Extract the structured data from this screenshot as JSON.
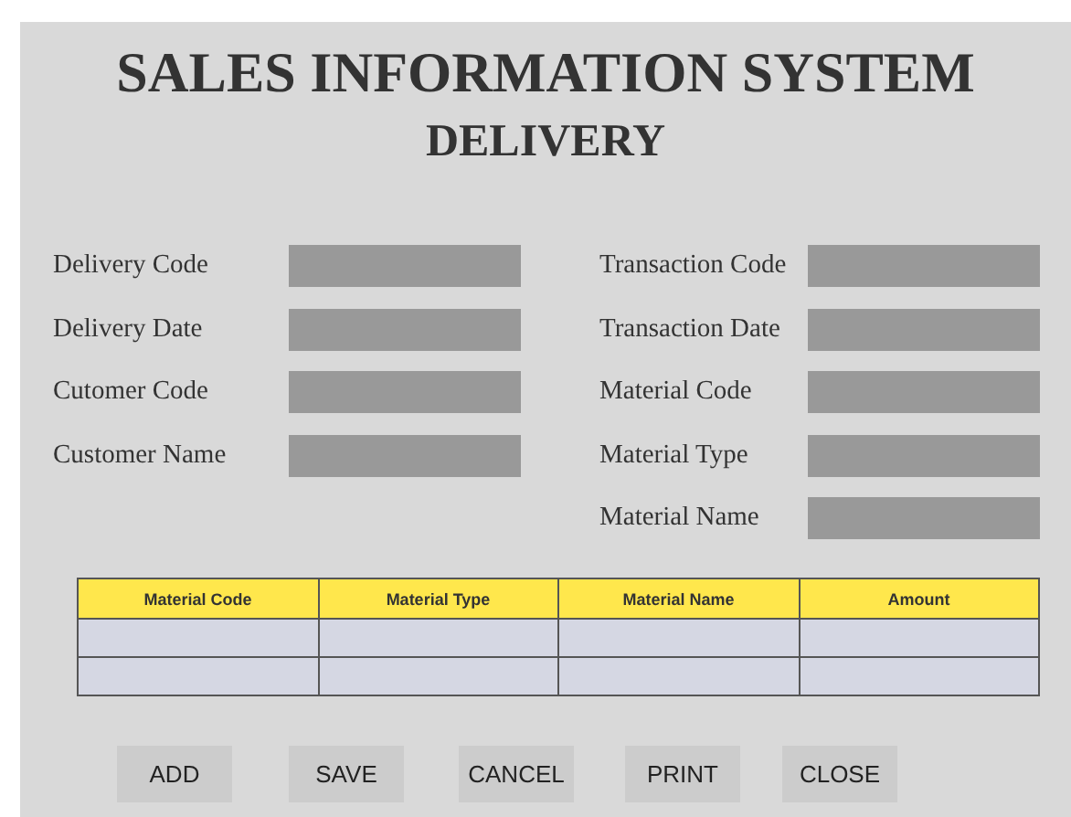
{
  "title": "SALES INFORMATION SYSTEM",
  "subtitle": "DELIVERY",
  "left_fields": [
    {
      "label": "Delivery Code"
    },
    {
      "label": "Delivery Date"
    },
    {
      "label": "Cutomer Code"
    },
    {
      "label": "Customer Name"
    }
  ],
  "right_fields": [
    {
      "label": "Transaction Code"
    },
    {
      "label": "Transaction Date"
    },
    {
      "label": "Material Code"
    },
    {
      "label": "Material Type"
    },
    {
      "label": "Material Name"
    }
  ],
  "table": {
    "columns": [
      "Material Code",
      "Material Type",
      "Material Name",
      "Amount"
    ],
    "rows": [
      {
        "kind": "empty"
      },
      {
        "kind": "empty"
      }
    ]
  },
  "buttons": [
    "ADD",
    "SAVE",
    "CANCEL",
    "PRINT",
    "CLOSE"
  ]
}
